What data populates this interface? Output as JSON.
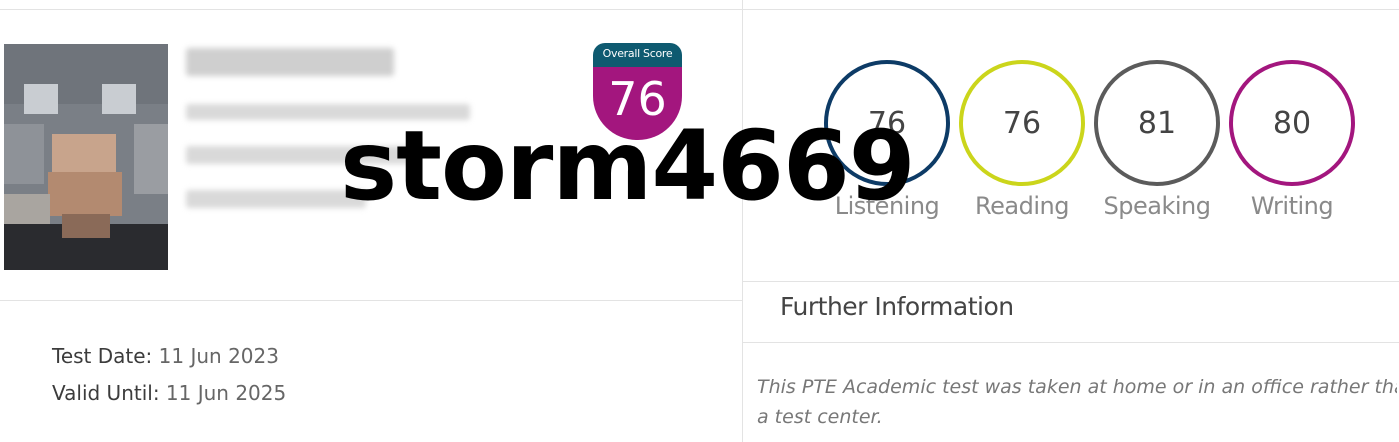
{
  "overall": {
    "label": "Overall Score",
    "score": "76"
  },
  "skills": [
    {
      "name": "Listening",
      "score": "76",
      "color": "#0d3b66"
    },
    {
      "name": "Reading",
      "score": "76",
      "color": "#cbd51b"
    },
    {
      "name": "Speaking",
      "score": "81",
      "color": "#5b5b5b"
    },
    {
      "name": "Writing",
      "score": "80",
      "color": "#a3167e"
    }
  ],
  "watermark": "storm4669",
  "dates": {
    "test_label": "Test Date:",
    "test_value": "11 Jun 2023",
    "valid_label": "Valid Until:",
    "valid_value": "11 Jun 2025"
  },
  "further": {
    "title": "Further Information",
    "line1": "This PTE Academic test was taken at home or in an office rather tha",
    "line2": "a test center."
  },
  "colors": {
    "badge_top": "#0e5a70",
    "badge_bottom": "#a3167e"
  }
}
